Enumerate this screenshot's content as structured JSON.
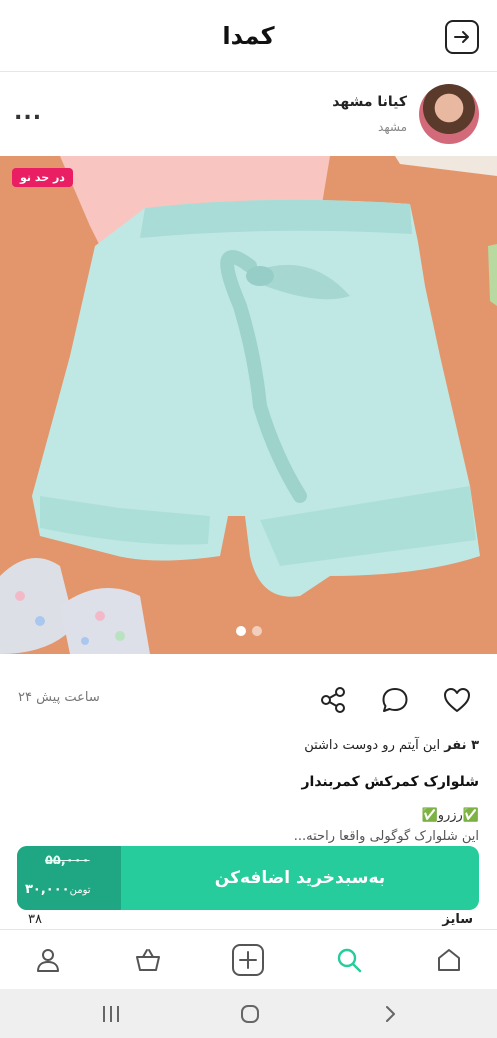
{
  "app": {
    "logo_text": "کمدا"
  },
  "seller": {
    "name": "کیانا مشهد",
    "city": "مشهد",
    "more_label": "..."
  },
  "product": {
    "badge": "در حد نو",
    "posted_time": "۲۴ ساعت پیش",
    "likes_count": "۳ نفر",
    "likes_text": "این آیتم رو دوست داشتن",
    "title": "شلوارک کمرکش کمربندار",
    "description_line1": "✅رزرو✅",
    "description_line2": "این شلوارک گوگولی واقعا راحته...",
    "size_label": "سایز",
    "size_value": "۳۸",
    "image_count": 2,
    "active_image": 1
  },
  "cart": {
    "label": "به‌سبدخرید اضافه‌کن",
    "old_price": "۵۵,۰۰۰",
    "new_price": "۳۰,۰۰۰",
    "currency": "تومن"
  },
  "colors": {
    "accent": "#26cc9b",
    "accent_dark": "#1fa783",
    "badge": "#e91e63"
  },
  "icons": {
    "header": "exit-arrow-icon",
    "actions": [
      "heart-icon",
      "comment-icon",
      "share-icon"
    ],
    "nav": [
      "home-icon",
      "search-icon",
      "add-icon",
      "basket-icon",
      "profile-icon"
    ],
    "system": [
      "back-icon",
      "home-circle-icon",
      "recents-icon"
    ]
  }
}
